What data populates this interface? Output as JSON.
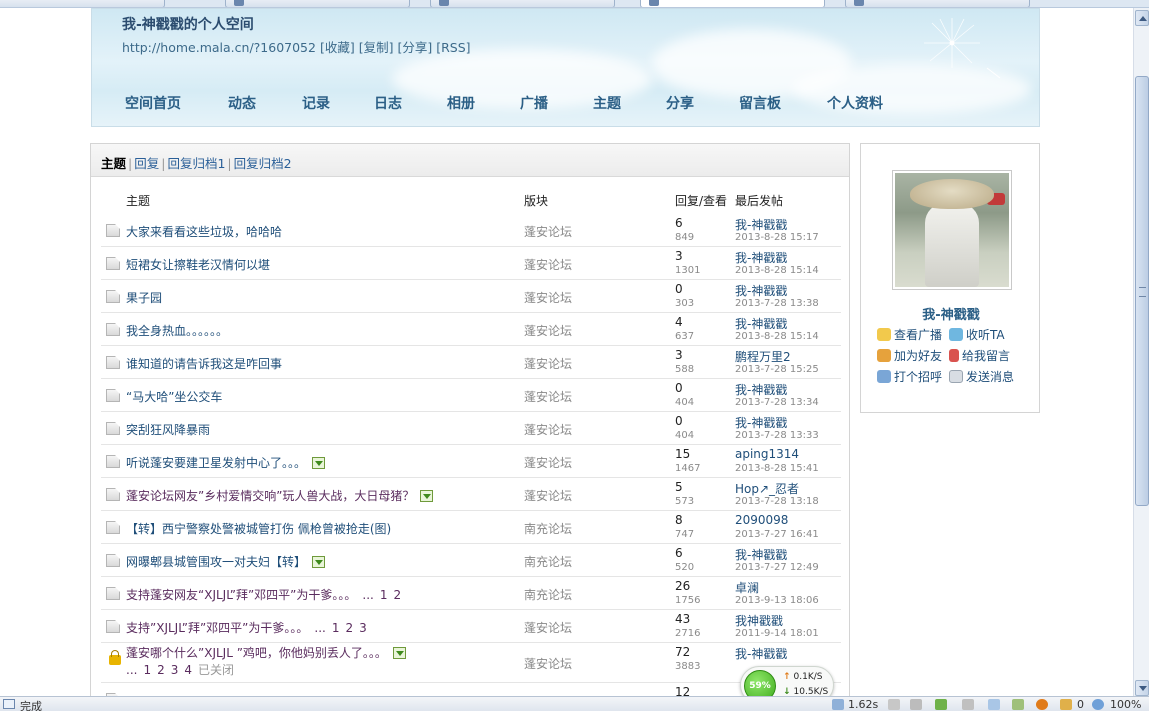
{
  "header": {
    "title": "我-神戳戳的个人空间",
    "url": "http://home.mala.cn/?1607052",
    "links": [
      "[收藏]",
      "[复制]",
      "[分享]",
      "[RSS]"
    ],
    "nav": [
      "空间首页",
      "动态",
      "记录",
      "日志",
      "相册",
      "广播",
      "主题",
      "分享",
      "留言板",
      "个人资料"
    ]
  },
  "subtabs": {
    "active": "主题",
    "items": [
      "回复",
      "回复归档1",
      "回复归档2"
    ]
  },
  "table": {
    "columns": {
      "topic": "主题",
      "board": "版块",
      "replies_views": "回复/查看",
      "last_post": "最后发帖"
    },
    "rows": [
      {
        "title": "大家来看看这些垃圾，哈哈哈",
        "board": "蓬安论坛",
        "replies": "6",
        "views": "849",
        "last_user": "我-神戳戳",
        "last_time": "2013-8-28 15:17"
      },
      {
        "title": "短裙女让擦鞋老汉情何以堪",
        "board": "蓬安论坛",
        "replies": "3",
        "views": "1301",
        "last_user": "我-神戳戳",
        "last_time": "2013-8-28 15:14"
      },
      {
        "title": "果子园",
        "board": "蓬安论坛",
        "replies": "0",
        "views": "303",
        "last_user": "我-神戳戳",
        "last_time": "2013-7-28 13:38"
      },
      {
        "title": "我全身热血。。。。。。",
        "board": "蓬安论坛",
        "replies": "4",
        "views": "637",
        "last_user": "我-神戳戳",
        "last_time": "2013-8-28 15:14"
      },
      {
        "title": "谁知道的请告诉我这是咋回事",
        "board": "蓬安论坛",
        "replies": "3",
        "views": "588",
        "last_user": "鹏程万里2",
        "last_time": "2013-7-28 15:25"
      },
      {
        "title": "“马大哈”坐公交车",
        "board": "蓬安论坛",
        "replies": "0",
        "views": "404",
        "last_user": "我-神戳戳",
        "last_time": "2013-7-28 13:34"
      },
      {
        "title": "突刮狂风降暴雨",
        "board": "蓬安论坛",
        "replies": "0",
        "views": "404",
        "last_user": "我-神戳戳",
        "last_time": "2013-7-28 13:33"
      },
      {
        "title": "听说蓬安要建卫星发射中心了。。。",
        "board": "蓬安论坛",
        "replies": "15",
        "views": "1467",
        "last_user": "aping1314",
        "last_time": "2013-8-28 15:41"
      },
      {
        "title": "蓬安论坛网友”乡村爱情交响”玩人兽大战，大日母猪？",
        "board": "蓬安论坛",
        "replies": "5",
        "views": "573",
        "last_user": "Hop↗_忍者",
        "last_time": "2013-7-28 13:18"
      },
      {
        "title": "【转】西宁警察处警被城管打伤 佩枪曾被抢走(图)",
        "board": "南充论坛",
        "replies": "8",
        "views": "747",
        "last_user": "2090098",
        "last_time": "2013-7-27 16:41"
      },
      {
        "title": "网曝郫县城管围攻一对夫妇【转】",
        "board": "南充论坛",
        "replies": "6",
        "views": "520",
        "last_user": "我-神戳戳",
        "last_time": "2013-7-27 12:49"
      },
      {
        "title": "支持蓬安网友“XJLJL”拜”邓四平”为干爹。。。",
        "board": "南充论坛",
        "replies": "26",
        "views": "1756",
        "last_user": "卓澜",
        "last_time": "2013-9-13 18:06"
      },
      {
        "title": "支持”XJLJL”拜”邓四平”为干爹。。。",
        "board": "蓬安论坛",
        "replies": "43",
        "views": "2716",
        "last_user": "我神戳戳",
        "last_time": "2011-9-14 18:01"
      },
      {
        "title": "蓬安哪个什么”XJLJL ”鸡吧，你他妈别丢人了。。。",
        "board": "蓬安论坛",
        "replies": "72",
        "views": "3883",
        "last_user": "我-神戳戳",
        "last_time": "",
        "closed": "已关闭"
      },
      {
        "title": "",
        "board": "",
        "replies": "12",
        "views": "",
        "last_user": "",
        "last_time": ""
      }
    ],
    "pager_ellipsis": "...",
    "row11_pages": [
      "1",
      "2"
    ],
    "row12_pages": [
      "1",
      "2",
      "3"
    ],
    "row13_pages": [
      "1",
      "2",
      "3",
      "4"
    ]
  },
  "profile": {
    "name": "我-神戳戳",
    "actions": [
      "查看广播",
      "收听TA",
      "加为好友",
      "给我留言",
      "打个招呼",
      "发送消息"
    ]
  },
  "statusbar": {
    "status": "完成",
    "time": "1.62s",
    "count": "0",
    "zoom": "100%"
  },
  "network": {
    "percent": "59%",
    "up": "0.1K/S",
    "down": "10.5K/S"
  }
}
